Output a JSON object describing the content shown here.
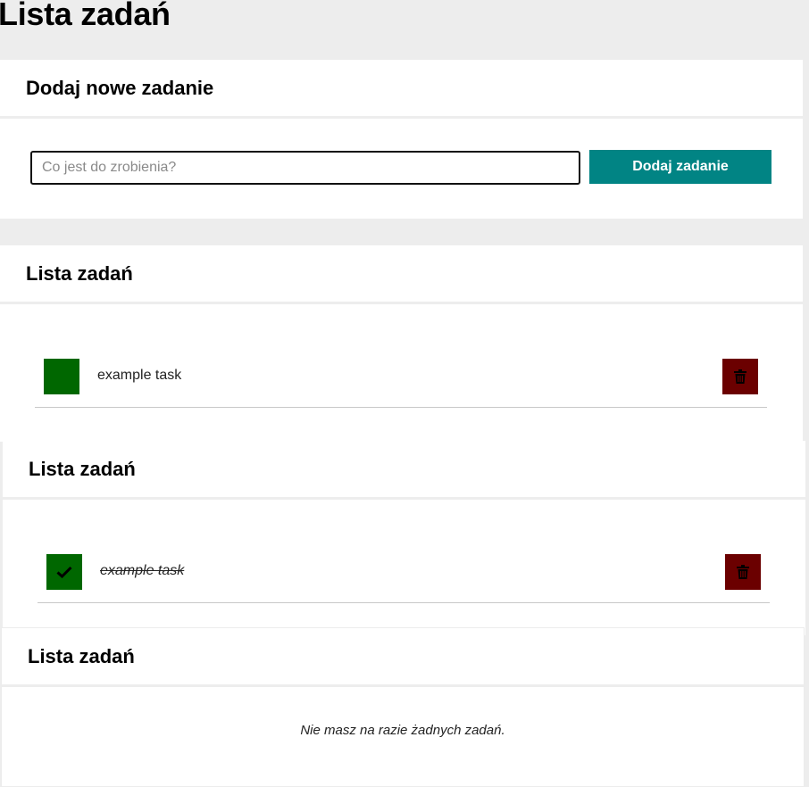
{
  "app": {
    "title": "Lista zadań"
  },
  "add_section": {
    "title": "Dodaj nowe zadanie",
    "input_placeholder": "Co jest do zrobienia?",
    "input_value": "",
    "button_label": "Dodaj zadanie"
  },
  "lists": [
    {
      "title": "Lista zadań",
      "tasks": [
        {
          "text": "example task",
          "done": false
        }
      ]
    },
    {
      "title": "Lista zadań",
      "tasks": [
        {
          "text": "example task",
          "done": true
        }
      ]
    },
    {
      "title": "Lista zadań",
      "tasks": [],
      "empty_message": "Nie masz na razie żadnych zadań."
    }
  ],
  "icons": {
    "done_toggle": "check-icon",
    "delete": "trash-icon"
  },
  "colors": {
    "accent": "#018484",
    "done_toggle": "#006700",
    "delete": "#6b0000",
    "background": "#ededed"
  }
}
